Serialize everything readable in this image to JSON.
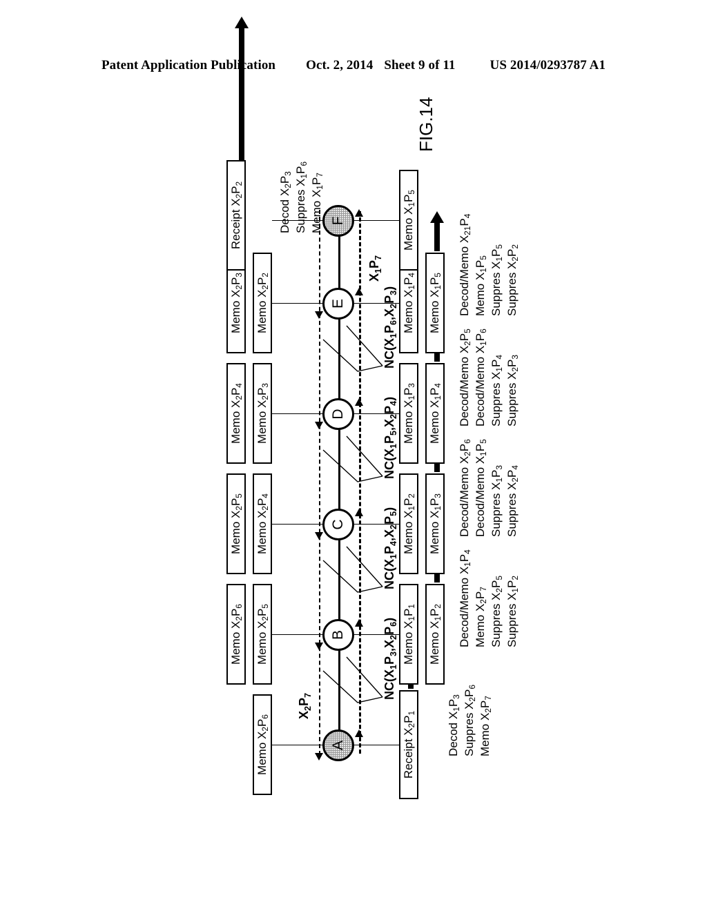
{
  "header": {
    "publication": "Patent Application Publication",
    "date": "Oct. 2, 2014",
    "sheet": "Sheet 9 of 11",
    "patent_number": "US 2014/0293787 A1"
  },
  "figure": {
    "caption": "FIG.14",
    "nodes": [
      {
        "id": "A",
        "label": "A",
        "shaded": true
      },
      {
        "id": "B",
        "label": "B",
        "shaded": false
      },
      {
        "id": "C",
        "label": "C",
        "shaded": false
      },
      {
        "id": "D",
        "label": "D",
        "shaded": false
      },
      {
        "id": "E",
        "label": "E",
        "shaded": false
      },
      {
        "id": "F",
        "label": "F",
        "shaded": true
      }
    ],
    "top_boxes": [
      {
        "node": "A",
        "outer": "",
        "inner": "Memo X2P6"
      },
      {
        "node": "B",
        "outer": "Memo X2P6",
        "inner": "Memo X2P5"
      },
      {
        "node": "C",
        "outer": "Memo X2P5",
        "inner": "Memo X2P4"
      },
      {
        "node": "D",
        "outer": "Memo X2P4",
        "inner": "Memo X2P3"
      },
      {
        "node": "E",
        "outer": "Memo X2P3",
        "inner": "Memo X2P2"
      },
      {
        "node": "F",
        "outer": "",
        "inner": "Receipt X2P2"
      }
    ],
    "bottom_boxes": [
      {
        "node": "A",
        "inner": "Receipt X2P1",
        "outer": ""
      },
      {
        "node": "B",
        "inner": "Memo X1P1",
        "outer": "Memo X1P2"
      },
      {
        "node": "C",
        "inner": "Memo X1P2",
        "outer": "Memo X1P3"
      },
      {
        "node": "D",
        "inner": "Memo X1P3",
        "outer": "Memo X1P4"
      },
      {
        "node": "E",
        "inner": "Memo X1P4",
        "outer": "Memo X1P5"
      },
      {
        "node": "F",
        "inner": "Memo X1P5",
        "outer": ""
      }
    ],
    "nc_labels": [
      {
        "between": "A-B",
        "text": "NC(X1P3,X2P6)"
      },
      {
        "between": "B-C",
        "text": "NC(X1P4,X2P5)"
      },
      {
        "between": "C-D",
        "text": "NC(X1P5,X2P4)"
      },
      {
        "between": "D-E",
        "text": "NC(X1P6,X2P3)"
      }
    ],
    "edge_labels": [
      {
        "at": "A-B",
        "text": "X2P7"
      },
      {
        "at": "E-F",
        "text": "X1P7"
      }
    ],
    "outcomes": [
      {
        "node": "A",
        "lines": [
          "Decod X1P3",
          "Suppres X2P6",
          "Memo X2P7"
        ]
      },
      {
        "node": "B",
        "lines": [
          "Decod/Memo X1P4",
          "Memo X2P7",
          "Suppres X2P5",
          "Suppres X1P2"
        ]
      },
      {
        "node": "C",
        "lines": [
          "Decod/Memo X2P6",
          "Decod/Memo X1P5",
          "Suppres X1P3",
          "Suppres X2P4"
        ]
      },
      {
        "node": "D",
        "lines": [
          "Decod/Memo X2P5",
          "Decod/Memo X1P6",
          "Suppres X1P4",
          "Suppres X2P3"
        ]
      },
      {
        "node": "E",
        "lines": [
          "Decod/Memo X21P4",
          "Memo X1P5",
          "Suppres X1P5",
          "Suppres X2P2"
        ]
      },
      {
        "node": "F",
        "lines": [
          "Decod X2P3",
          "Suppres X1P6",
          "Memo X1P7"
        ]
      }
    ]
  }
}
